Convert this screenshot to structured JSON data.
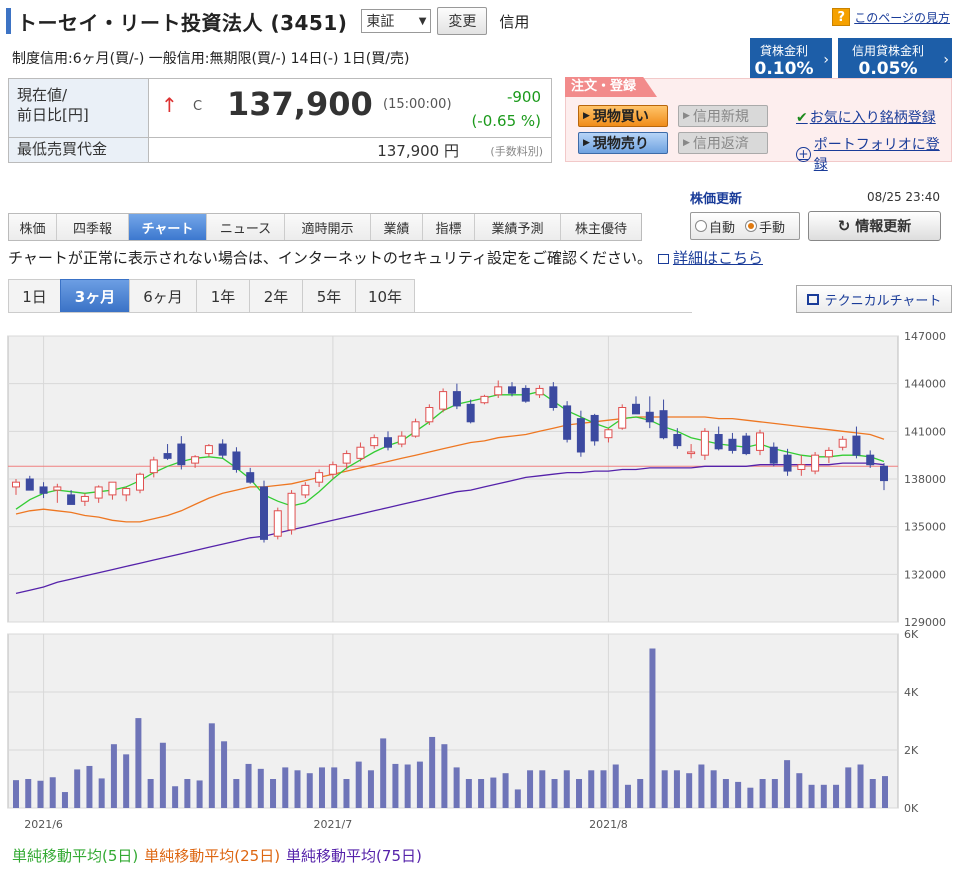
{
  "header": {
    "title": "トーセイ・リート投資法人 (3451)",
    "market": "東証",
    "change_label": "変更",
    "credit_label": "信用",
    "help_link": "このページの見方",
    "credit_info": "制度信用:6ヶ月(買/-)  一般信用:無期限(買/-)  14日(-)  1日(買/売)"
  },
  "rates": {
    "lending": {
      "label": "貸株金利",
      "value": "0.10%"
    },
    "credit_lending": {
      "label": "信用貸株金利",
      "value": "0.05%"
    }
  },
  "price": {
    "label_line1": "現在値/",
    "label_line2": "前日比[円]",
    "arrow": "↑",
    "mark": "C",
    "current": "137,900",
    "time": "(15:00:00)",
    "change": "-900",
    "change_pct": "(-0.65 %)",
    "min_label": "最低売買代金",
    "min_value": "137,900 円",
    "min_note": "(手数料別)"
  },
  "order": {
    "tag": "注文・登録",
    "buy": "現物買い",
    "sell": "現物売り",
    "credit_new": "信用新規",
    "credit_return": "信用返済",
    "favorite": "お気に入り銘柄登録",
    "portfolio": "ポートフォリオに登録"
  },
  "update": {
    "title": "株価更新",
    "date": "08/25 23:40",
    "auto": "自動",
    "manual": "手動",
    "refresh": "情報更新"
  },
  "nav_tabs": [
    "株価",
    "四季報",
    "チャート",
    "ニュース",
    "適時開示",
    "業績",
    "指標",
    "業績予測",
    "株主優待"
  ],
  "notice": {
    "text": "チャートが正常に表示されない場合は、インターネットのセキュリティ設定をご確認ください。",
    "link": "詳細はこちら"
  },
  "period_tabs": [
    "1日",
    "3ヶ月",
    "6ヶ月",
    "1年",
    "2年",
    "5年",
    "10年"
  ],
  "technical_button": "テクニカルチャート",
  "legend": {
    "ma5": "単純移動平均(5日)",
    "ma25": "単純移動平均(25日)",
    "ma75": "単純移動平均(75日)"
  },
  "colors": {
    "up": "#e05050",
    "down": "#3c4aa0",
    "ma5": "#33cc33",
    "ma25": "#ee7722",
    "ma75": "#5522aa",
    "volume": "#6e74b8",
    "accent": "#3a72c6",
    "green_text": "#1c9a1c"
  },
  "chart_data": [
    {
      "type": "candlestick",
      "y_ticks": [
        "147000",
        "144000",
        "141000",
        "138000",
        "135000",
        "132000",
        "129000"
      ],
      "ylim": [
        129000,
        147000
      ],
      "x_labels": [
        {
          "label": "2021/6",
          "index": 2
        },
        {
          "label": "2021/7",
          "index": 23
        },
        {
          "label": "2021/8",
          "index": 43
        }
      ],
      "ref_line": 138800,
      "candles": [
        [
          137500,
          138000,
          137000,
          137800
        ],
        [
          138000,
          138200,
          137600,
          137300
        ],
        [
          137500,
          137800,
          136800,
          137100
        ],
        [
          137300,
          137700,
          136500,
          137500
        ],
        [
          137000,
          137300,
          136500,
          136400
        ],
        [
          136600,
          137100,
          136300,
          136900
        ],
        [
          136800,
          137600,
          136500,
          137500
        ],
        [
          137000,
          137700,
          136700,
          137800
        ],
        [
          137000,
          137500,
          136600,
          137400
        ],
        [
          137300,
          138400,
          137100,
          138300
        ],
        [
          138400,
          139400,
          138100,
          139200
        ],
        [
          139600,
          140200,
          139200,
          139300
        ],
        [
          140200,
          140700,
          138600,
          138900
        ],
        [
          139000,
          139500,
          138700,
          139400
        ],
        [
          139600,
          140200,
          139400,
          140100
        ],
        [
          140200,
          140500,
          139300,
          139500
        ],
        [
          139700,
          140000,
          138400,
          138600
        ],
        [
          138400,
          138700,
          137700,
          137800
        ],
        [
          137500,
          137900,
          134000,
          134200
        ],
        [
          134400,
          136200,
          134200,
          136000
        ],
        [
          134800,
          137300,
          134500,
          137100
        ],
        [
          137000,
          137800,
          136800,
          137600
        ],
        [
          137800,
          138600,
          137500,
          138400
        ],
        [
          138300,
          139100,
          138000,
          138900
        ],
        [
          139000,
          139800,
          138600,
          139600
        ],
        [
          139300,
          140300,
          139100,
          140000
        ],
        [
          140100,
          140800,
          139900,
          140600
        ],
        [
          140600,
          141000,
          139800,
          140000
        ],
        [
          140200,
          141000,
          140000,
          140700
        ],
        [
          140700,
          141800,
          140600,
          141600
        ],
        [
          141600,
          142700,
          141400,
          142500
        ],
        [
          142400,
          143700,
          142200,
          143500
        ],
        [
          143500,
          144000,
          142400,
          142600
        ],
        [
          142700,
          143000,
          141500,
          141600
        ],
        [
          142800,
          143300,
          142700,
          143200
        ],
        [
          143300,
          144200,
          143100,
          143800
        ],
        [
          143800,
          144100,
          143200,
          143400
        ],
        [
          143700,
          143900,
          142800,
          142900
        ],
        [
          143300,
          143900,
          143100,
          143700
        ],
        [
          143800,
          144100,
          142300,
          142500
        ],
        [
          142600,
          142900,
          140300,
          140500
        ],
        [
          141800,
          142300,
          139400,
          139700
        ],
        [
          142000,
          142100,
          140100,
          140400
        ],
        [
          140600,
          141200,
          140300,
          141100
        ],
        [
          141200,
          142700,
          141100,
          142500
        ],
        [
          142700,
          143200,
          142200,
          142100
        ],
        [
          142200,
          143200,
          141200,
          141600
        ],
        [
          142300,
          143000,
          140500,
          140600
        ],
        [
          140800,
          141200,
          139900,
          140100
        ],
        [
          139600,
          140200,
          139300,
          139700
        ],
        [
          139500,
          141200,
          139200,
          141000
        ],
        [
          140800,
          141300,
          139800,
          139900
        ],
        [
          140500,
          140900,
          139600,
          139800
        ],
        [
          140700,
          140900,
          139500,
          139600
        ],
        [
          139800,
          141100,
          139500,
          140900
        ],
        [
          140000,
          140300,
          138800,
          139000
        ],
        [
          139500,
          139900,
          138200,
          138500
        ],
        [
          138600,
          139500,
          138200,
          138900
        ],
        [
          138500,
          139700,
          138300,
          139500
        ],
        [
          139400,
          140000,
          139000,
          139800
        ],
        [
          140000,
          140700,
          139800,
          140500
        ],
        [
          140700,
          141300,
          139300,
          139500
        ],
        [
          139500,
          139800,
          138700,
          138900
        ],
        [
          138800,
          139000,
          137300,
          137900
        ]
      ],
      "ma5": [
        136100,
        136700,
        137100,
        137300,
        137200,
        137100,
        137200,
        137300,
        137500,
        137900,
        138400,
        138800,
        139100,
        139300,
        139400,
        139300,
        138700,
        138000,
        137000,
        136600,
        136300,
        136500,
        137200,
        138000,
        138700,
        139200,
        139700,
        140100,
        140400,
        141000,
        141600,
        142300,
        142700,
        142900,
        143100,
        143300,
        143300,
        143300,
        143500,
        142900,
        142300,
        141900,
        141500,
        141200,
        141800,
        141900,
        141700,
        141300,
        141000,
        140600,
        140400,
        140200,
        140100,
        140000,
        140200,
        139900,
        139700,
        139500,
        139400,
        139400,
        139500,
        139500,
        139400,
        139100
      ],
      "ma25": [
        135800,
        136000,
        136100,
        136000,
        135900,
        135700,
        135600,
        135400,
        135300,
        135300,
        135500,
        135700,
        136000,
        136400,
        136800,
        137100,
        137300,
        137500,
        137500,
        137600,
        137700,
        137900,
        138100,
        138300,
        138500,
        138700,
        138900,
        139100,
        139300,
        139500,
        139700,
        139900,
        140100,
        140300,
        140400,
        140600,
        140700,
        140800,
        141000,
        141200,
        141400,
        141500,
        141600,
        141700,
        141800,
        141900,
        141900,
        141900,
        141900,
        141900,
        141900,
        141800,
        141800,
        141700,
        141600,
        141500,
        141400,
        141300,
        141200,
        141100,
        141000,
        140900,
        140800,
        140500
      ],
      "ma75": [
        130800,
        131000,
        131200,
        131500,
        131700,
        131900,
        132100,
        132300,
        132500,
        132700,
        132900,
        133100,
        133300,
        133500,
        133700,
        133900,
        134100,
        134300,
        134400,
        134600,
        134800,
        135000,
        135200,
        135400,
        135600,
        135800,
        136000,
        136200,
        136400,
        136600,
        136800,
        137000,
        137200,
        137300,
        137500,
        137700,
        137900,
        138100,
        138200,
        138300,
        138400,
        138400,
        138500,
        138500,
        138600,
        138600,
        138700,
        138700,
        138700,
        138700,
        138800,
        138800,
        138800,
        138800,
        138900,
        138900,
        138900,
        138900,
        138900,
        138900,
        139000,
        139000,
        139000,
        138900
      ]
    },
    {
      "type": "bar",
      "title": "",
      "y_ticks": [
        "6K",
        "4K",
        "2K",
        "0K"
      ],
      "ylim": [
        0,
        6000
      ],
      "values": [
        960,
        1000,
        940,
        1060,
        550,
        1330,
        1450,
        1020,
        2200,
        1850,
        3100,
        1000,
        2250,
        750,
        1000,
        950,
        2920,
        2300,
        1000,
        1520,
        1350,
        1000,
        1400,
        1300,
        1200,
        1400,
        1400,
        1000,
        1600,
        1300,
        2400,
        1520,
        1500,
        1600,
        2450,
        2200,
        1400,
        1000,
        1000,
        1050,
        1200,
        640,
        1300,
        1300,
        1000,
        1300,
        1000,
        1300,
        1300,
        1500,
        800,
        1000,
        5500,
        1300,
        1300,
        1200,
        1500,
        1300,
        1000,
        900,
        700,
        1000,
        1000,
        1650,
        1200,
        800,
        800,
        800,
        1400,
        1500,
        1000,
        1100
      ]
    }
  ]
}
